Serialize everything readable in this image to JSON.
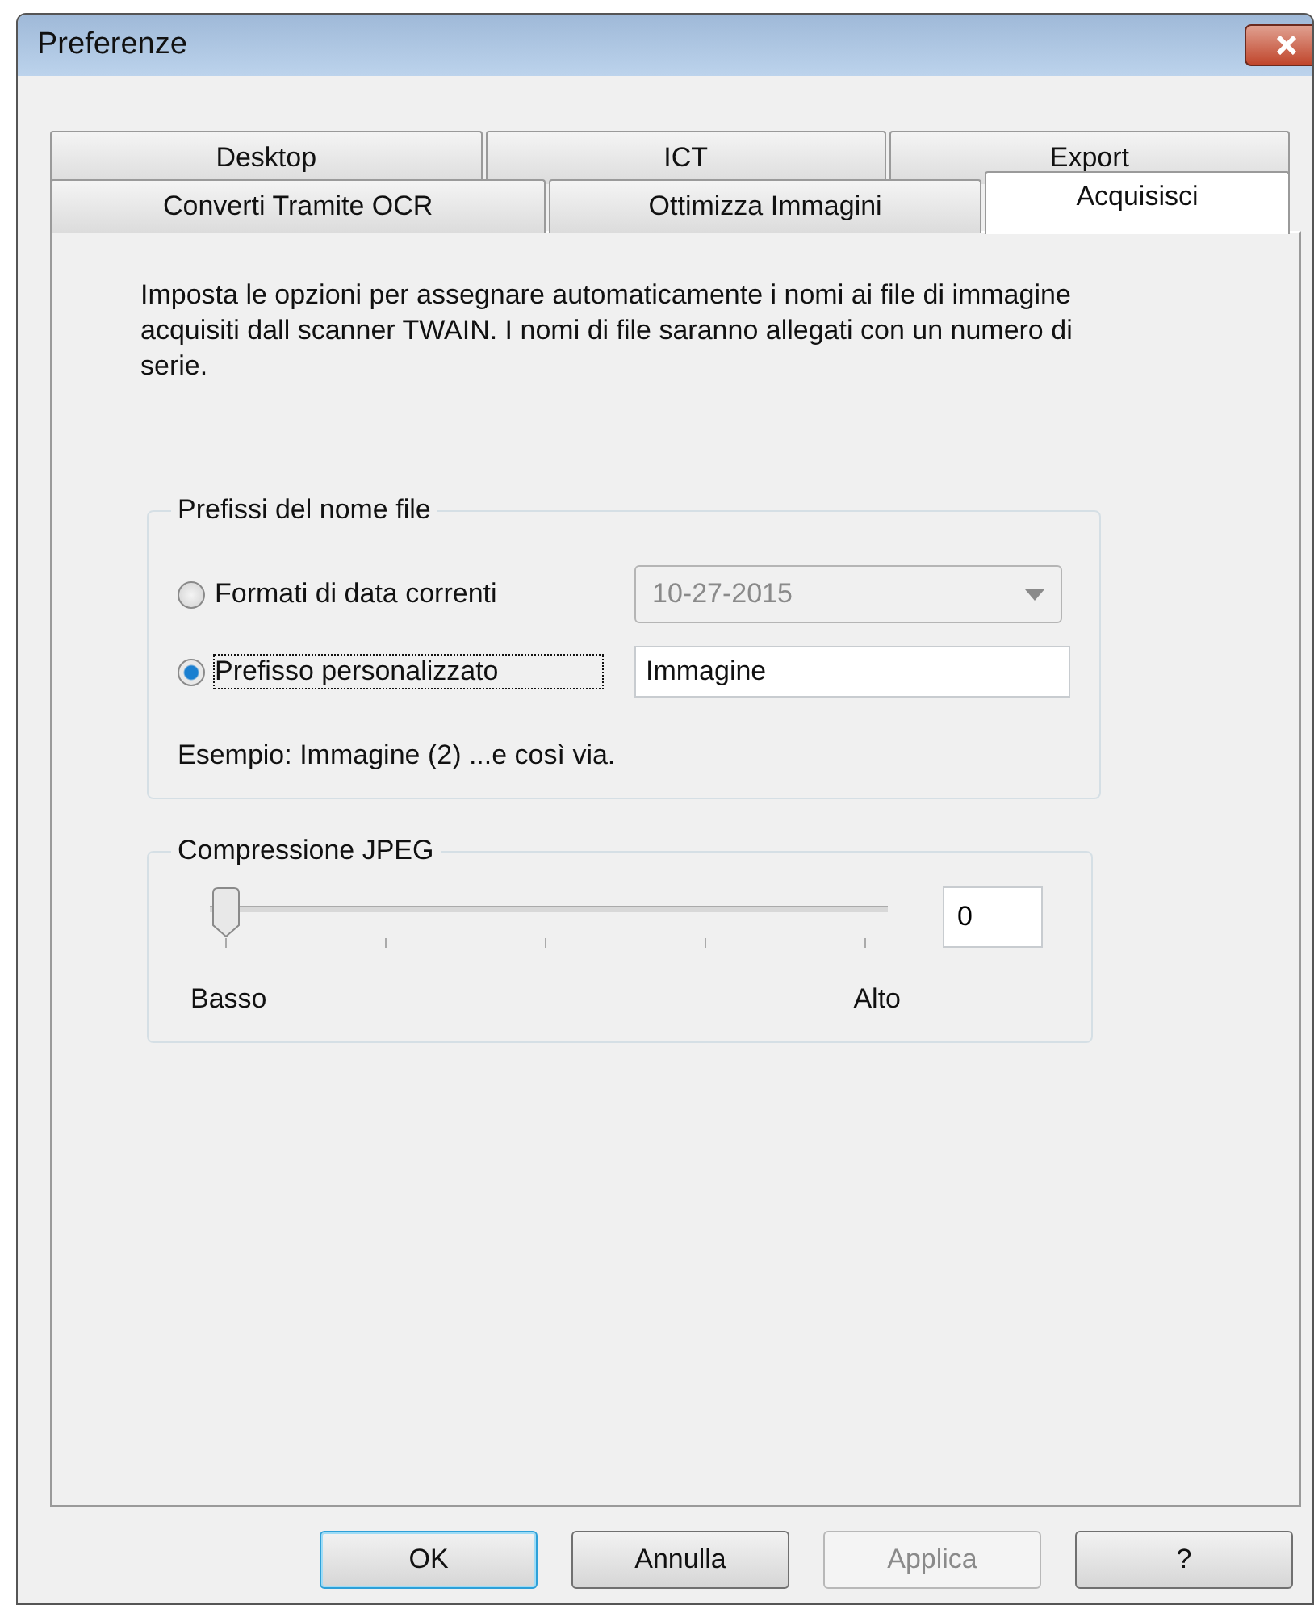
{
  "window": {
    "title": "Preferenze"
  },
  "tab_rows": [
    [
      {
        "label": "Desktop",
        "selected": false
      },
      {
        "label": "ICT",
        "selected": false
      },
      {
        "label": "Export",
        "selected": false
      }
    ],
    [
      {
        "label": "Converti Tramite OCR",
        "selected": false
      },
      {
        "label": "Ottimizza Immagini",
        "selected": false
      },
      {
        "label": "Acquisisci",
        "selected": true
      }
    ]
  ],
  "description": "Imposta le opzioni per assegnare automaticamente i nomi ai file di immagine acquisiti dall scanner TWAIN. I nomi di file saranno allegati con un numero di serie.",
  "prefix_group": {
    "title": "Prefissi del nome file",
    "options": [
      {
        "kind": "dropdown",
        "label": "Formati di data correnti",
        "selected": false,
        "value": "10-27-2015",
        "disabled": true
      },
      {
        "kind": "text",
        "label": "Prefisso personalizzato",
        "selected": true,
        "value": "Immagine",
        "disabled": false
      }
    ],
    "example": "Esempio: Immagine (2) ...e così via."
  },
  "jpeg_group": {
    "title": "Compressione JPEG",
    "slider": {
      "level": 0,
      "min_label": "Basso",
      "max_label": "Alto"
    },
    "value": "0"
  },
  "buttons": [
    {
      "label": "OK",
      "default": true,
      "disabled": false
    },
    {
      "label": "Annulla",
      "default": false,
      "disabled": false
    },
    {
      "label": "Applica",
      "default": false,
      "disabled": true
    },
    {
      "label": "?",
      "default": false,
      "disabled": false
    }
  ]
}
